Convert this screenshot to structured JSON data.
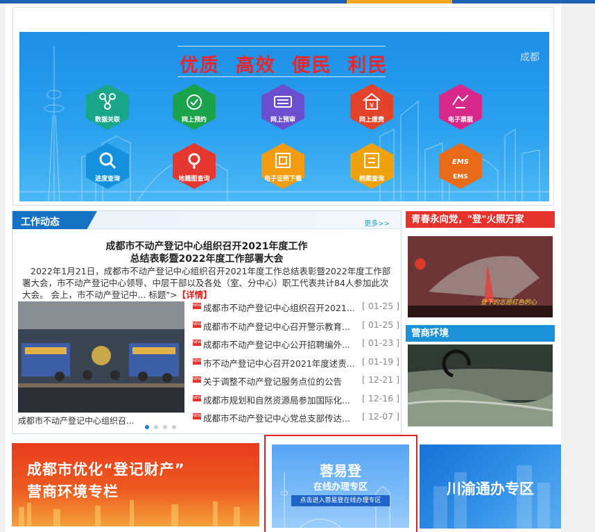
{
  "banner": {
    "slogan": "优质  高效  便民  利民",
    "logo_text": "成都",
    "services": [
      {
        "label": "数据关联",
        "color": "#18a58a",
        "icon": "share-icon"
      },
      {
        "label": "网上预约",
        "color": "#1aa34a",
        "icon": "alarm-clock-icon"
      },
      {
        "label": "网上预审",
        "color": "#6c4fcf",
        "icon": "keyboard-icon"
      },
      {
        "label": "网上缴费",
        "color": "#e4432b",
        "icon": "house-yen-icon"
      },
      {
        "label": "电子票据",
        "color": "#d8288b",
        "icon": "ticket-icon"
      },
      {
        "label": "进度查询",
        "color": "#1590dc",
        "icon": "magnifier-icon"
      },
      {
        "label": "地籍图查询",
        "color": "#e4372f",
        "icon": "map-pin-icon"
      },
      {
        "label": "电子证照下载",
        "color": "#f39c12",
        "icon": "certificate-icon"
      },
      {
        "label": "档案查询",
        "color": "#f0a10e",
        "icon": "archive-icon"
      },
      {
        "label": "EMS",
        "color": "#e96a18",
        "icon": "ems-icon"
      }
    ]
  },
  "news": {
    "tab_title": "工作动态",
    "more_label": "更多>>",
    "headline_line1": "成都市不动产登记中心组织召开2021年度工作",
    "headline_line2": "总结表彰暨2022年度工作部署大会",
    "summary": "2022年1月21日，成都市不动产登记中心组织召开2021年度工作总结表彰暨2022年度工作部署大会，市不动产登记中心领导、中层干部以及各处（室、分中心）职工代表共计84人参加此次大会。     会上，市不动产登记中... 标题\">",
    "detail_label": "【详情】",
    "photo_caption": "成都市不动产登记中心组织召...",
    "new_badge": "NEW",
    "items": [
      {
        "title": "成都市不动产登记中心组织召开2021...",
        "date": "[ 01-25 ]"
      },
      {
        "title": "成都市不动产登记中心召开警示教育...",
        "date": "[ 01-25 ]"
      },
      {
        "title": "成都市不动产登记中心公开招聘编外...",
        "date": "[ 01-23 ]"
      },
      {
        "title": "市不动产登记中心召开2021年度述责...",
        "date": "[ 01-19 ]"
      },
      {
        "title": "关于调整不动产登记服务点位的公告",
        "date": "[ 12-21 ]"
      },
      {
        "title": "成都市规划和自然资源局参加国际化...",
        "date": "[ 12-16 ]"
      },
      {
        "title": "成都市不动产登记中心党总支部传达...",
        "date": "[ 12-07 ]"
      }
    ]
  },
  "side": {
    "youth_title": "青春永向党，\"登\"火照万家",
    "youth_caption": "登下的志愿红色的心",
    "business_title": "营商环境",
    "youth_color": "#e5322d",
    "business_color": "#1b91d8"
  },
  "bottom": {
    "b1_line1": "成都市优化“登记财产”",
    "b1_line2": "营商环境专栏",
    "b2_title": "蓉易登",
    "b2_subtitle": "在线办理专区",
    "b2_button": "点击进入蓉易登在线办理专区",
    "b3_title": "川渝通办专区"
  }
}
